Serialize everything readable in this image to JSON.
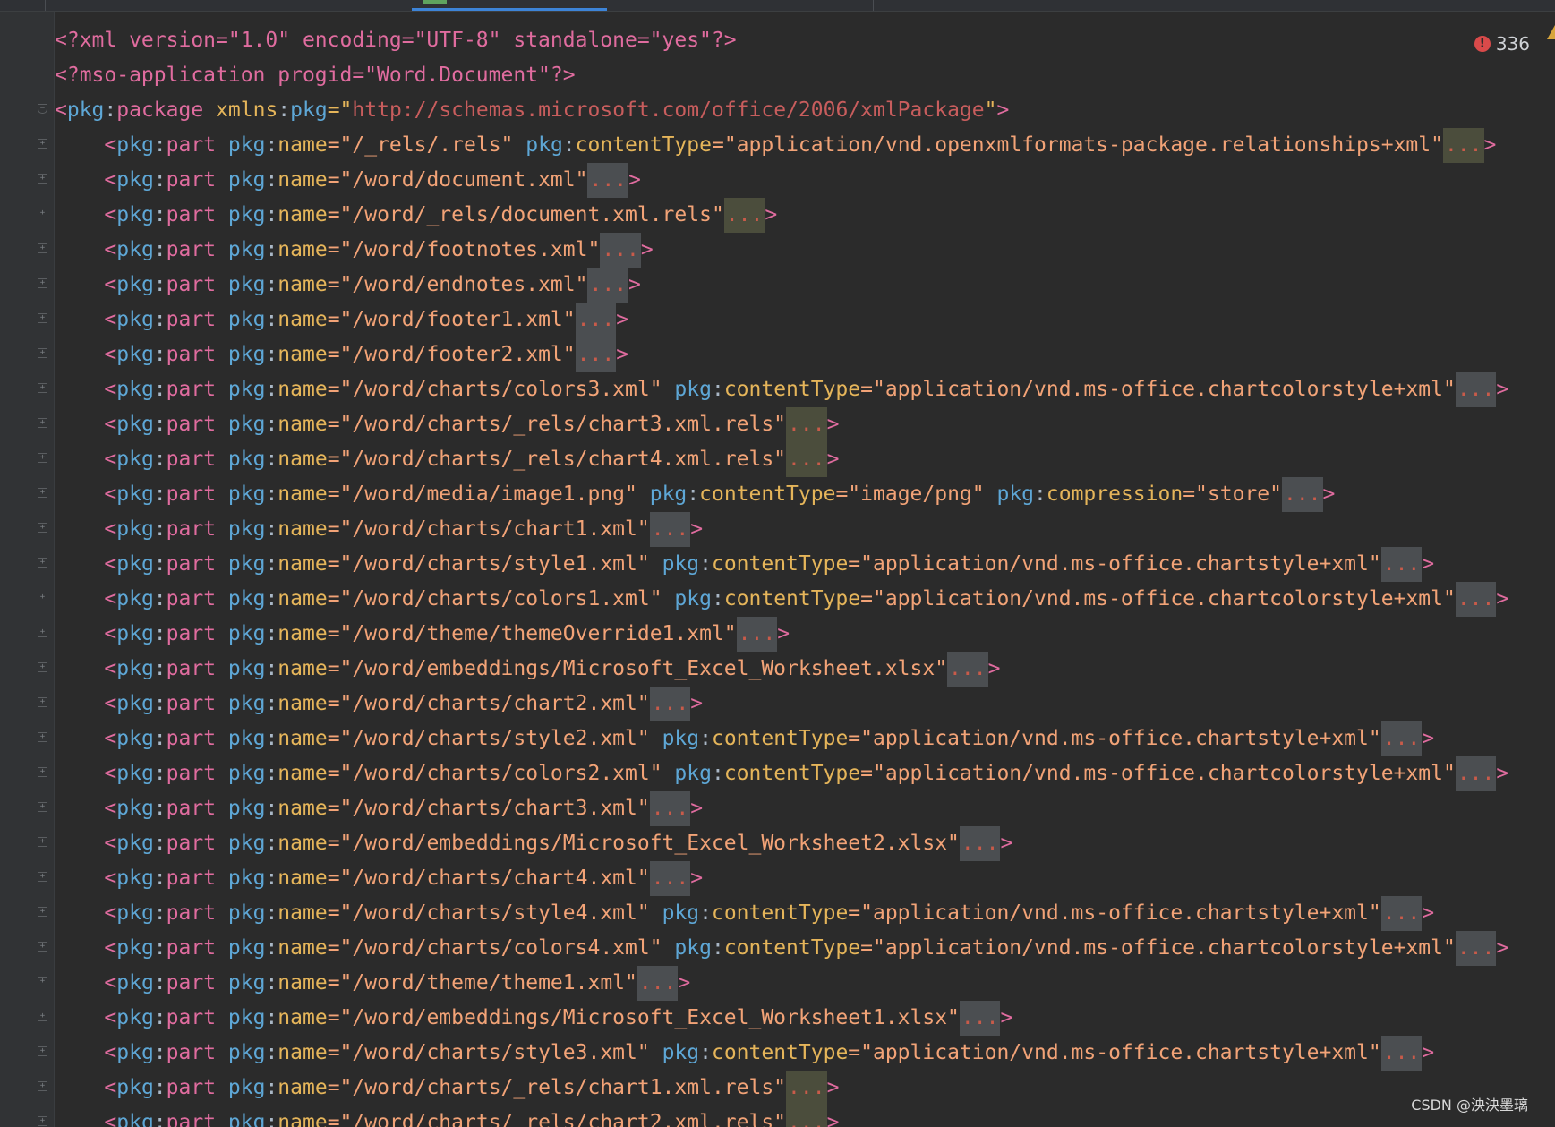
{
  "editor": {
    "problems": {
      "error_count": "336",
      "icon": "error-icon",
      "warning_icon": "warning-icon"
    },
    "watermark": "CSDN @泱泱墨璃",
    "colors": {
      "background": "#2b2b2b",
      "gutter": "#313335",
      "tag": "#e06c9f",
      "namespace": "#5ea7d6",
      "attribute": "#e5b55a",
      "value": "#f2a377",
      "url": "#c85d5d",
      "fold_placeholder_bg": "#4b4e51",
      "active_tab_underline": "#3d84d8"
    },
    "lines": [
      {
        "kind": "pi",
        "text": "<?xml version=\"1.0\" encoding=\"UTF-8\" standalone=\"yes\"?>"
      },
      {
        "kind": "pi",
        "text": "<?mso-application progid=\"Word.Document\"?>"
      },
      {
        "kind": "root",
        "tag": "package",
        "attr": "xmlns",
        "attr_ns": "pkg",
        "url": "http://schemas.microsoft.com/office/2006/xmlPackage"
      },
      {
        "kind": "part",
        "name": "/_rels/.rels",
        "extra": [
          {
            "attr": "contentType",
            "value": "application/vnd.openxmlformats-package.relationships+xml"
          }
        ],
        "dots_style": "green"
      },
      {
        "kind": "part",
        "name": "/word/document.xml",
        "extra": [],
        "dots_style": "grey"
      },
      {
        "kind": "part",
        "name": "/word/_rels/document.xml.rels",
        "extra": [],
        "dots_style": "green"
      },
      {
        "kind": "part",
        "name": "/word/footnotes.xml",
        "extra": [],
        "dots_style": "grey"
      },
      {
        "kind": "part",
        "name": "/word/endnotes.xml",
        "extra": [],
        "dots_style": "grey"
      },
      {
        "kind": "part",
        "name": "/word/footer1.xml",
        "extra": [],
        "dots_style": "grey"
      },
      {
        "kind": "part",
        "name": "/word/footer2.xml",
        "extra": [],
        "dots_style": "grey"
      },
      {
        "kind": "part",
        "name": "/word/charts/colors3.xml",
        "extra": [
          {
            "attr": "contentType",
            "value": "application/vnd.ms-office.chartcolorstyle+xml"
          }
        ],
        "dots_style": "grey"
      },
      {
        "kind": "part",
        "name": "/word/charts/_rels/chart3.xml.rels",
        "extra": [],
        "dots_style": "green"
      },
      {
        "kind": "part",
        "name": "/word/charts/_rels/chart4.xml.rels",
        "extra": [],
        "dots_style": "green"
      },
      {
        "kind": "part",
        "name": "/word/media/image1.png",
        "extra": [
          {
            "attr": "contentType",
            "value": "image/png"
          },
          {
            "attr": "compression",
            "value": "store"
          }
        ],
        "dots_style": "grey"
      },
      {
        "kind": "part",
        "name": "/word/charts/chart1.xml",
        "extra": [],
        "dots_style": "grey"
      },
      {
        "kind": "part",
        "name": "/word/charts/style1.xml",
        "extra": [
          {
            "attr": "contentType",
            "value": "application/vnd.ms-office.chartstyle+xml"
          }
        ],
        "dots_style": "grey"
      },
      {
        "kind": "part",
        "name": "/word/charts/colors1.xml",
        "extra": [
          {
            "attr": "contentType",
            "value": "application/vnd.ms-office.chartcolorstyle+xml"
          }
        ],
        "dots_style": "grey"
      },
      {
        "kind": "part",
        "name": "/word/theme/themeOverride1.xml",
        "extra": [],
        "dots_style": "grey"
      },
      {
        "kind": "part",
        "name": "/word/embeddings/Microsoft_Excel_Worksheet.xlsx",
        "extra": [],
        "dots_style": "grey"
      },
      {
        "kind": "part",
        "name": "/word/charts/chart2.xml",
        "extra": [],
        "dots_style": "grey"
      },
      {
        "kind": "part",
        "name": "/word/charts/style2.xml",
        "extra": [
          {
            "attr": "contentType",
            "value": "application/vnd.ms-office.chartstyle+xml"
          }
        ],
        "dots_style": "grey"
      },
      {
        "kind": "part",
        "name": "/word/charts/colors2.xml",
        "extra": [
          {
            "attr": "contentType",
            "value": "application/vnd.ms-office.chartcolorstyle+xml"
          }
        ],
        "dots_style": "grey"
      },
      {
        "kind": "part",
        "name": "/word/charts/chart3.xml",
        "extra": [],
        "dots_style": "grey"
      },
      {
        "kind": "part",
        "name": "/word/embeddings/Microsoft_Excel_Worksheet2.xlsx",
        "extra": [],
        "dots_style": "grey"
      },
      {
        "kind": "part",
        "name": "/word/charts/chart4.xml",
        "extra": [],
        "dots_style": "grey"
      },
      {
        "kind": "part",
        "name": "/word/charts/style4.xml",
        "extra": [
          {
            "attr": "contentType",
            "value": "application/vnd.ms-office.chartstyle+xml"
          }
        ],
        "dots_style": "grey"
      },
      {
        "kind": "part",
        "name": "/word/charts/colors4.xml",
        "extra": [
          {
            "attr": "contentType",
            "value": "application/vnd.ms-office.chartcolorstyle+xml"
          }
        ],
        "dots_style": "grey"
      },
      {
        "kind": "part",
        "name": "/word/theme/theme1.xml",
        "extra": [],
        "dots_style": "grey"
      },
      {
        "kind": "part",
        "name": "/word/embeddings/Microsoft_Excel_Worksheet1.xlsx",
        "extra": [],
        "dots_style": "grey"
      },
      {
        "kind": "part",
        "name": "/word/charts/style3.xml",
        "extra": [
          {
            "attr": "contentType",
            "value": "application/vnd.ms-office.chartstyle+xml"
          }
        ],
        "dots_style": "grey"
      },
      {
        "kind": "part",
        "name": "/word/charts/_rels/chart1.xml.rels",
        "extra": [],
        "dots_style": "green"
      },
      {
        "kind": "part",
        "name": "/word/charts/_rels/chart2.xml.rels",
        "extra": [],
        "dots_style": "green"
      }
    ]
  }
}
